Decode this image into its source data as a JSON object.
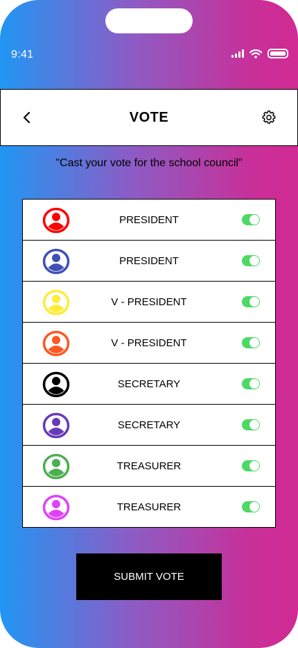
{
  "status_bar": {
    "time": "9:41",
    "icons": [
      "cellular-signal-icon",
      "wifi-icon",
      "battery-icon"
    ]
  },
  "header": {
    "title": "VOTE",
    "back_icon": "chevron-left-icon",
    "settings_icon": "gear-icon"
  },
  "subtitle": "\"Cast your vote for the school council\"",
  "candidates": [
    {
      "role": "PRESIDENT",
      "color": "#ff0000",
      "selected": true
    },
    {
      "role": "PRESIDENT",
      "color": "#3f51b5",
      "selected": true
    },
    {
      "role": "V - PRESIDENT",
      "color": "#ffeb3b",
      "selected": true
    },
    {
      "role": "V - PRESIDENT",
      "color": "#ff5722",
      "selected": true
    },
    {
      "role": "SECRETARY",
      "color": "#000000",
      "selected": true
    },
    {
      "role": "SECRETARY",
      "color": "#673ab7",
      "selected": true
    },
    {
      "role": "TREASURER",
      "color": "#4caf50",
      "selected": true
    },
    {
      "role": "TREASURER",
      "color": "#e040fb",
      "selected": true
    }
  ],
  "toggle_color": "#4cd964",
  "submit_label": "SUBMIT VOTE"
}
